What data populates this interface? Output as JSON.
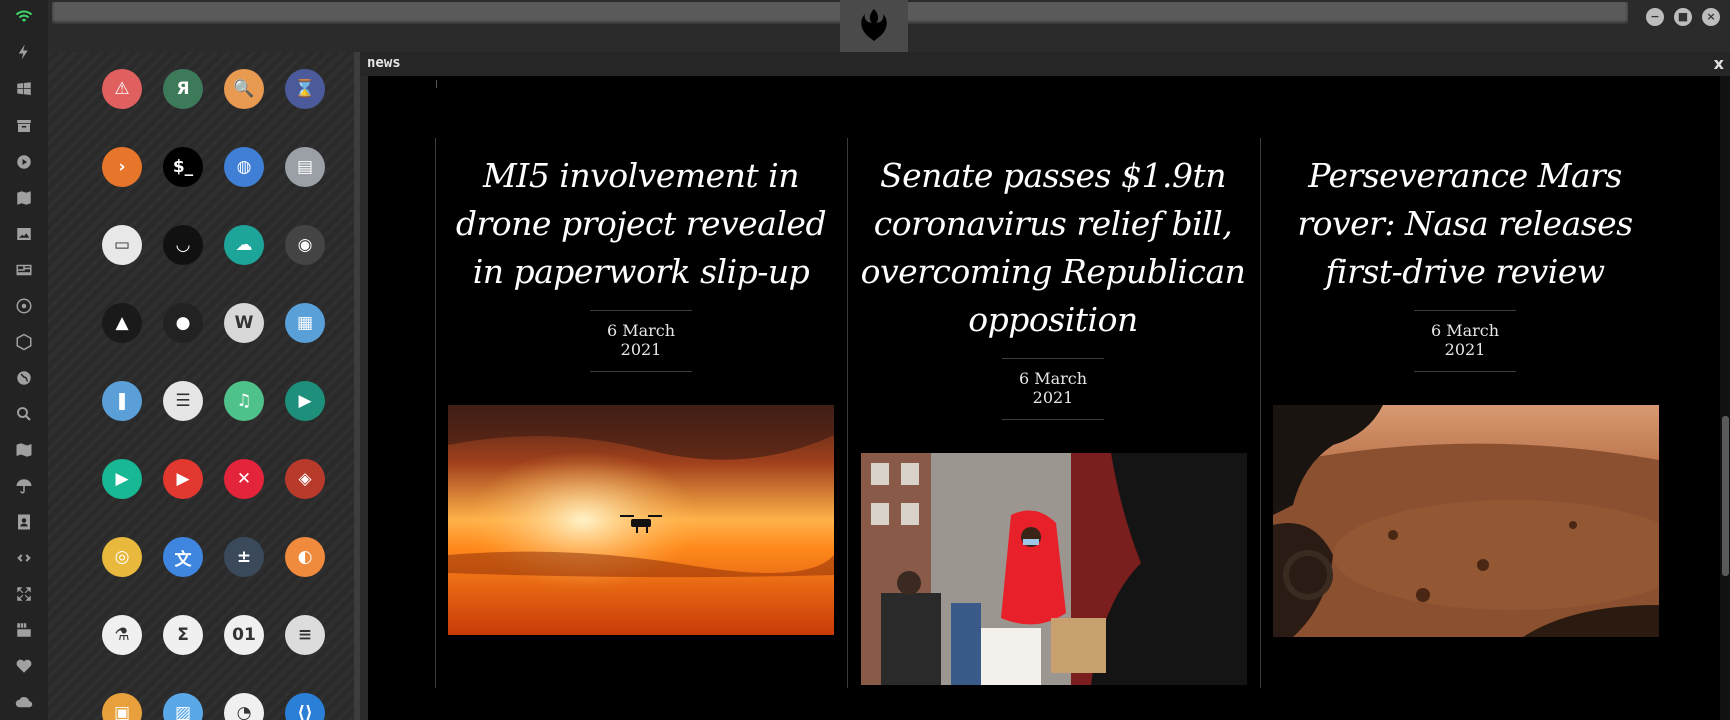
{
  "window": {
    "minimize_label": "−",
    "maximize_label": "■",
    "close_label": "×"
  },
  "system_rail": {
    "items": [
      "wifi-icon",
      "bolt-icon",
      "windows-icon",
      "archive-icon",
      "play-icon",
      "map-book-icon",
      "image-icon",
      "newspaper-icon",
      "empire-icon",
      "hex-icon",
      "globe-icon",
      "search-icon",
      "map-icon",
      "umbrella-icon",
      "contacts-icon",
      "link-icon",
      "expand-icon",
      "youtube-icon",
      "heart-icon",
      "cloud-icon"
    ]
  },
  "launcher": {
    "apps": [
      {
        "name": "warning-app",
        "glyph": "⚠",
        "color": "#e06060"
      },
      {
        "name": "yandex-app",
        "glyph": "Я",
        "color": "#3c7a5a"
      },
      {
        "name": "search-app",
        "glyph": "🔍",
        "color": "#e89a50"
      },
      {
        "name": "hourglass-app",
        "glyph": "⌛",
        "color": "#4a5a9a"
      },
      {
        "name": "prompt-app",
        "glyph": "›",
        "color": "#e8762a"
      },
      {
        "name": "terminal-app",
        "glyph": "$_",
        "color": "#000000"
      },
      {
        "name": "browser-globe-app",
        "glyph": "◍",
        "color": "#3f7fd6"
      },
      {
        "name": "drive-app",
        "glyph": "▤",
        "color": "#9aa0a6"
      },
      {
        "name": "window-app",
        "glyph": "▭",
        "color": "#e8e8e8"
      },
      {
        "name": "mask-app",
        "glyph": "◡",
        "color": "#111111"
      },
      {
        "name": "cloud-lock-app",
        "glyph": "☁",
        "color": "#1ea59a"
      },
      {
        "name": "github-app",
        "glyph": "◉",
        "color": "#444444"
      },
      {
        "name": "starfleet-app",
        "glyph": "▲",
        "color": "#1a1a1a"
      },
      {
        "name": "death-star-app",
        "glyph": "●",
        "color": "#222222"
      },
      {
        "name": "wikipedia-app",
        "glyph": "W",
        "color": "#d8d8d8"
      },
      {
        "name": "world-map-app",
        "glyph": "▦",
        "color": "#5aa0d8"
      },
      {
        "name": "books-app",
        "glyph": "❚",
        "color": "#5a9fd8"
      },
      {
        "name": "notebook-app",
        "glyph": "☰",
        "color": "#e6e6e6"
      },
      {
        "name": "music-app",
        "glyph": "♫",
        "color": "#4fc18a"
      },
      {
        "name": "video-app",
        "glyph": "▶",
        "color": "#1e8f7a"
      },
      {
        "name": "player-app",
        "glyph": "▶",
        "color": "#17b893"
      },
      {
        "name": "youtube-app",
        "glyph": "▶",
        "color": "#e3382f"
      },
      {
        "name": "close-app",
        "glyph": "✕",
        "color": "#e3243b"
      },
      {
        "name": "ironman-app",
        "glyph": "◈",
        "color": "#b83a2a"
      },
      {
        "name": "c3po-app",
        "glyph": "◎",
        "color": "#e8b93c"
      },
      {
        "name": "translate-app",
        "glyph": "文",
        "color": "#3f86e0"
      },
      {
        "name": "calculator-app",
        "glyph": "±",
        "color": "#3a4a5a"
      },
      {
        "name": "photo-editor-app",
        "glyph": "◐",
        "color": "#f08a3c"
      },
      {
        "name": "chemistry-app",
        "glyph": "⚗",
        "color": "#f0f0f0"
      },
      {
        "name": "sigma-app",
        "glyph": "Σ",
        "color": "#f0f0f0"
      },
      {
        "name": "binary-app",
        "glyph": "01",
        "color": "#f0f0f0"
      },
      {
        "name": "text-editor-app",
        "glyph": "≡",
        "color": "#dcdcdc"
      },
      {
        "name": "document-app",
        "glyph": "▣",
        "color": "#e8a03c"
      },
      {
        "name": "image-viewer-app",
        "glyph": "▨",
        "color": "#5aa8e8"
      },
      {
        "name": "presentation-app",
        "glyph": "◔",
        "color": "#f0f0f0"
      },
      {
        "name": "vscode-app",
        "glyph": "⟨⟩",
        "color": "#2a7fd6"
      }
    ]
  },
  "news": {
    "panel_title": "news",
    "close_label": "x",
    "articles": [
      {
        "headline": "MI5 involvement in drone project revealed in paperwork slip-up",
        "date": "6 March 2021"
      },
      {
        "headline": "Senate passes $1.9tn coronavirus relief bill, overcoming Republican opposition",
        "date": "6 March 2021"
      },
      {
        "headline": "Perseverance Mars rover: Nasa releases first-drive review",
        "date": "6 March 2021"
      }
    ]
  }
}
